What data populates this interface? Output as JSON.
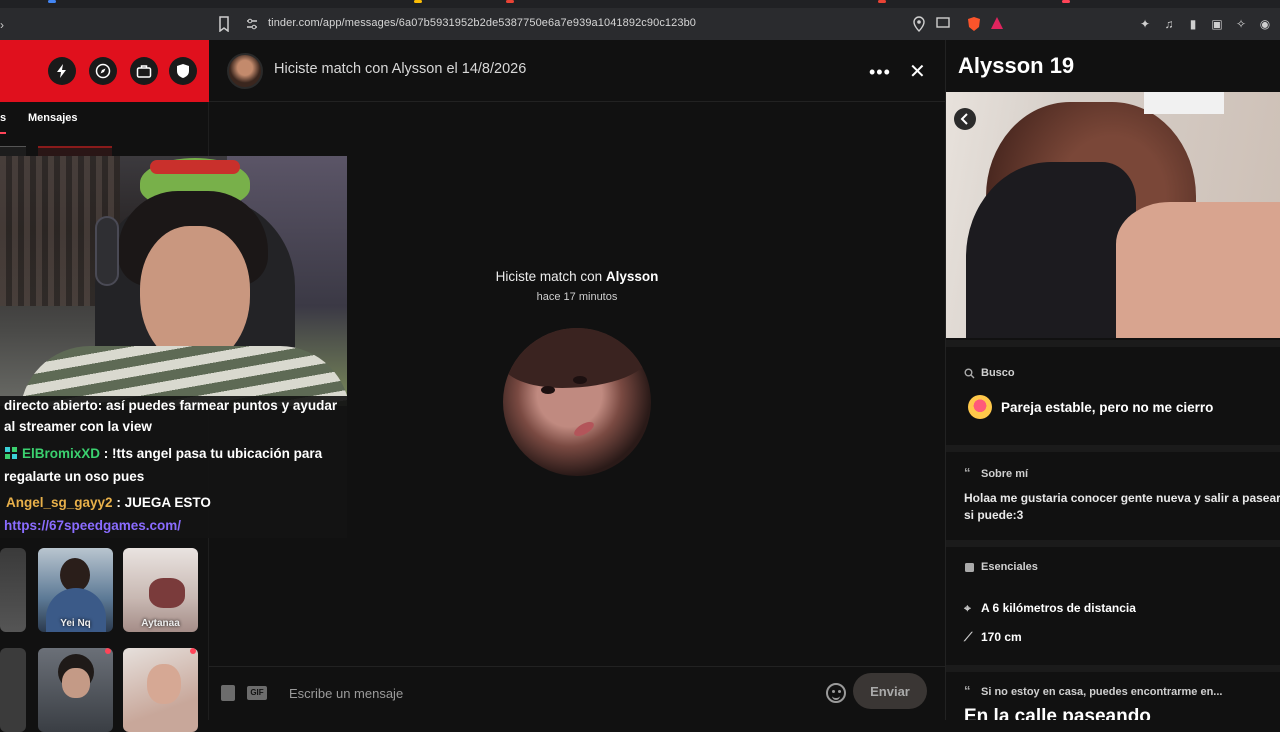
{
  "browser": {
    "url": "tinder.com/app/messages/6a07b5931952b2de5387750e6a7e939a1041892c90c123b0"
  },
  "sidebar": {
    "tabs": {
      "matches_fragment": "s",
      "messages": "Mensajes"
    },
    "tiles": [
      {
        "name": "Yei Nq"
      },
      {
        "name": "Aytanaa"
      }
    ]
  },
  "stream_chat": {
    "line1": "directo abierto: así puedes farmear puntos y ayudar",
    "line2": "al streamer con la view",
    "user1": "ElBromixXD",
    "msg1a": ": !tts angel pasa tu ubicación para",
    "msg1b": "regalarte un oso pues",
    "user2": "Angel_sg_gayy2",
    "msg2": ": JUEGA ESTO",
    "link": "https://67speedgames.com/"
  },
  "chat": {
    "title": "Hiciste match con Alysson el 14/8/2026",
    "match_note_prefix": "Hiciste match con ",
    "match_note_name": "Alysson",
    "match_time": "hace 17 minutos",
    "composer_placeholder": "Escribe un mensaje",
    "gif_label": "GIF",
    "send_label": "Enviar",
    "more_label": "•••",
    "close_label": "✕"
  },
  "profile": {
    "name_age": "Alysson 19",
    "busco_label": "Busco",
    "busco_value": "Pareja estable, pero no me cierro",
    "about_label": "Sobre mí",
    "about_text": "Holaa me gustaria conocer gente nueva y salir a pasear si puede:3",
    "essentials_label": "Esenciales",
    "distance": "A 6 kilómetros de distancia",
    "height": "170 cm",
    "prompt_label": "Si no estoy en casa, puedes encontrarme en...",
    "prompt_answer": "En la calle paseando"
  },
  "colors": {
    "brand_red": "#e0101d",
    "background": "#111111",
    "link": "#8a6cff",
    "user1": "#3bd16f",
    "user2": "#e8b04a"
  }
}
